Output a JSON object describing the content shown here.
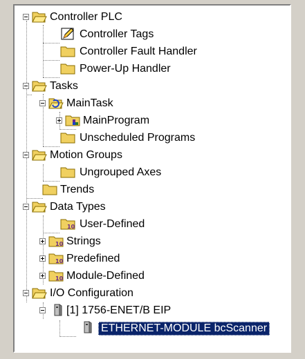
{
  "tree": {
    "controller": {
      "label": "Controller PLC",
      "icon": "folder-open-icon"
    },
    "controller_tags": {
      "label": "Controller Tags",
      "icon": "tags-edit-icon"
    },
    "fault_handler": {
      "label": "Controller Fault Handler",
      "icon": "folder-icon"
    },
    "powerup_handler": {
      "label": "Power-Up Handler",
      "icon": "folder-icon"
    },
    "tasks": {
      "label": "Tasks",
      "icon": "folder-open-icon"
    },
    "main_task": {
      "label": "MainTask",
      "icon": "task-folder-icon"
    },
    "main_program": {
      "label": "MainProgram",
      "icon": "program-folder-icon"
    },
    "unscheduled": {
      "label": "Unscheduled Programs",
      "icon": "folder-icon"
    },
    "motion_groups": {
      "label": "Motion Groups",
      "icon": "folder-open-icon"
    },
    "ungrouped_axes": {
      "label": "Ungrouped Axes",
      "icon": "folder-icon"
    },
    "trends": {
      "label": "Trends",
      "icon": "folder-icon"
    },
    "data_types": {
      "label": "Data Types",
      "icon": "folder-open-icon"
    },
    "user_defined": {
      "label": "User-Defined",
      "icon": "datatype-folder-icon"
    },
    "strings": {
      "label": "Strings",
      "icon": "datatype-folder-icon"
    },
    "predefined": {
      "label": "Predefined",
      "icon": "datatype-folder-icon"
    },
    "module_defined": {
      "label": "Module-Defined",
      "icon": "datatype-folder-icon"
    },
    "io_config": {
      "label": "I/O Configuration",
      "icon": "folder-open-icon"
    },
    "enet_module": {
      "label": "[1] 1756-ENET/B EIP",
      "icon": "module-icon"
    },
    "ethernet_module": {
      "label": "ETHERNET-MODULE bcScanner",
      "icon": "module-icon",
      "selected": true
    }
  },
  "colors": {
    "folder": "#f0d060",
    "selection": "#0a246a"
  }
}
